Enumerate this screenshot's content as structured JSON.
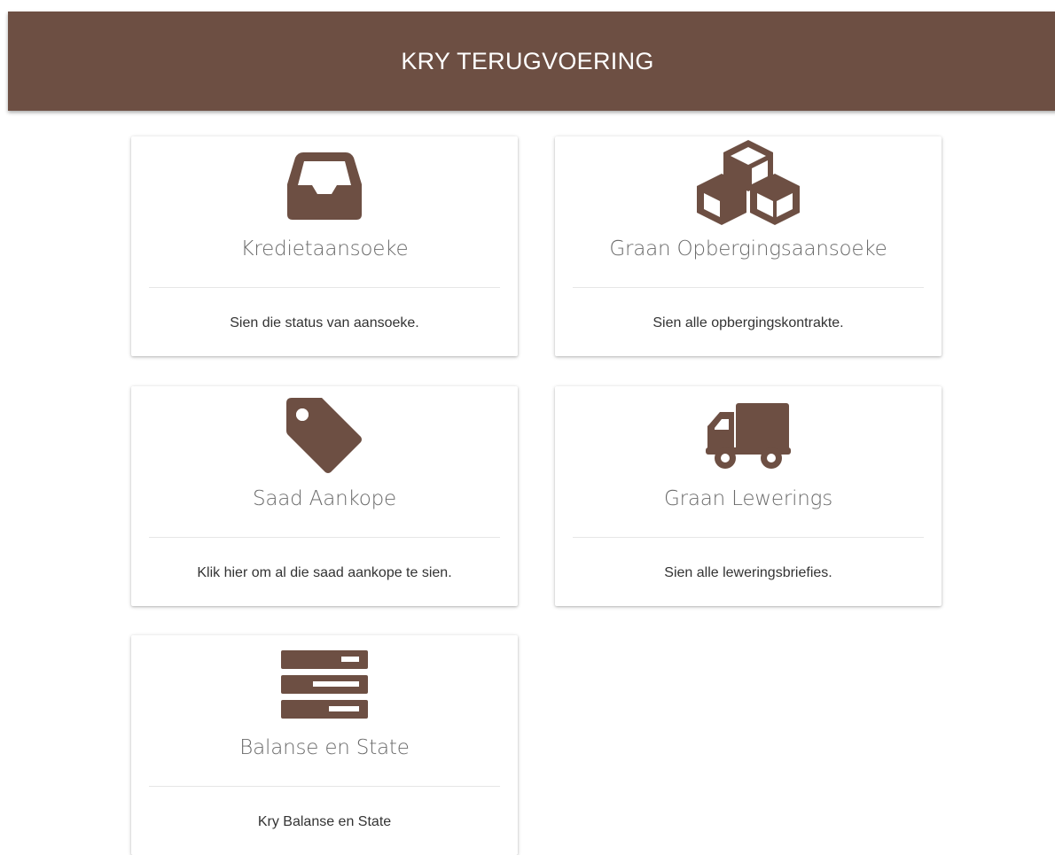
{
  "header": {
    "title": "KRY TERUGVOERING"
  },
  "theme": {
    "brand_color": "#6d4f43"
  },
  "cards": [
    {
      "icon": "inbox-tray-icon",
      "title": "Kredietaansoeke",
      "description": "Sien die status van aansoeke."
    },
    {
      "icon": "cubes-icon",
      "title": "Graan Opbergingsaansoeke",
      "description": "Sien alle opbergingskontrakte."
    },
    {
      "icon": "tag-icon",
      "title": "Saad Aankope",
      "description": "Klik hier om al die saad aankope te sien."
    },
    {
      "icon": "truck-icon",
      "title": "Graan Lewerings",
      "description": "Sien alle leweringsbriefies."
    },
    {
      "icon": "server-stack-icon",
      "title": "Balanse en State",
      "description": "Kry Balanse en State"
    }
  ]
}
